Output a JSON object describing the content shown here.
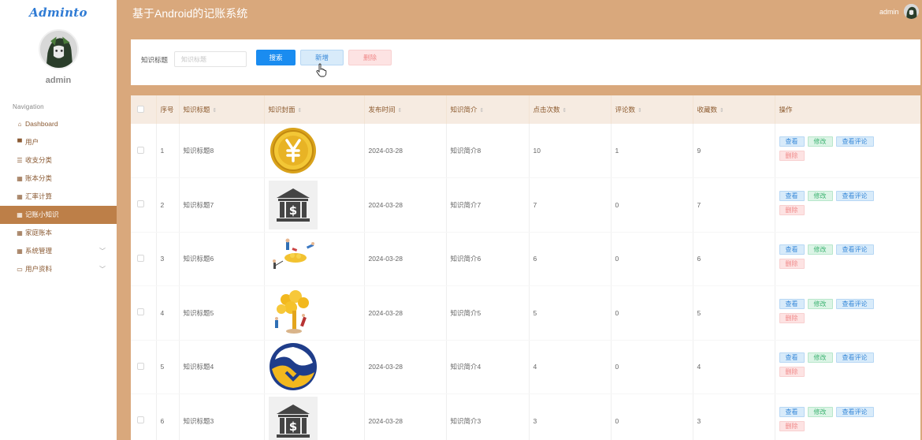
{
  "app": {
    "logo": "Adminto",
    "title": "基于Android的记账系统",
    "user": "admin"
  },
  "sidebar": {
    "username": "admin",
    "nav_title": "Navigation",
    "items": [
      {
        "label": "Dashboard",
        "icon": "home-icon"
      },
      {
        "label": "用户",
        "icon": "user-icon"
      },
      {
        "label": "收支分类",
        "icon": "list-icon"
      },
      {
        "label": "账本分类",
        "icon": "grid-icon"
      },
      {
        "label": "汇率计算",
        "icon": "grid-icon"
      },
      {
        "label": "记账小知识",
        "icon": "grid-icon",
        "active": true
      },
      {
        "label": "家庭账本",
        "icon": "grid-icon"
      },
      {
        "label": "系统管理",
        "icon": "grid-icon",
        "expandable": true
      },
      {
        "label": "用户资料",
        "icon": "calendar-icon",
        "expandable": true
      }
    ]
  },
  "search": {
    "label": "知识标题",
    "placeholder": "知识标题",
    "search_btn": "搜索",
    "add_btn": "新增",
    "delete_btn": "删除"
  },
  "table": {
    "headers": [
      "序号",
      "知识标题",
      "知识封面",
      "发布时间",
      "知识简介",
      "点击次数",
      "评论数",
      "收藏数",
      "操作"
    ],
    "actions": {
      "view": "查看",
      "edit": "修改",
      "comments": "查看评论",
      "delete": "删除"
    },
    "rows": [
      {
        "no": "1",
        "title": "知识标题8",
        "cover": "coin",
        "date": "2024-03-28",
        "intro": "知识简介8",
        "clicks": "10",
        "comments": "1",
        "favorites": "9"
      },
      {
        "no": "2",
        "title": "知识标题7",
        "cover": "bank",
        "date": "2024-03-28",
        "intro": "知识简介7",
        "clicks": "7",
        "comments": "0",
        "favorites": "7"
      },
      {
        "no": "3",
        "title": "知识标题6",
        "cover": "people-gold",
        "date": "2024-03-28",
        "intro": "知识简介6",
        "clicks": "6",
        "comments": "0",
        "favorites": "6"
      },
      {
        "no": "4",
        "title": "知识标题5",
        "cover": "money-tree",
        "date": "2024-03-28",
        "intro": "知识简介5",
        "clicks": "5",
        "comments": "0",
        "favorites": "5"
      },
      {
        "no": "5",
        "title": "知识标题4",
        "cover": "bank-logo",
        "date": "2024-03-28",
        "intro": "知识简介4",
        "clicks": "4",
        "comments": "0",
        "favorites": "4"
      },
      {
        "no": "6",
        "title": "知识标题3",
        "cover": "bank",
        "date": "2024-03-28",
        "intro": "知识简介3",
        "clicks": "3",
        "comments": "0",
        "favorites": "3"
      }
    ]
  },
  "colors": {
    "header_bg": "#d9a87c",
    "active_menu": "#bd7f48",
    "primary": "#1a8cf0",
    "logo": "#2f7bd4"
  }
}
